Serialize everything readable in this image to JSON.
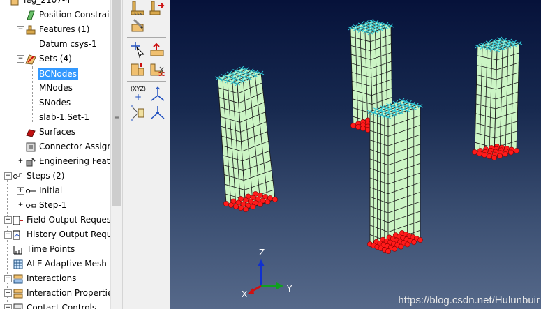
{
  "model_tree": {
    "items": [
      {
        "label": "leg_2107-4",
        "selected": false,
        "underlined": false
      },
      {
        "label": "Position Constraints",
        "selected": false,
        "underlined": false
      },
      {
        "label": "Features (1)",
        "selected": false,
        "underlined": false
      },
      {
        "label": "Datum csys-1",
        "selected": false,
        "underlined": false
      },
      {
        "label": "Sets (4)",
        "selected": false,
        "underlined": false
      },
      {
        "label": "BCNodes",
        "selected": true,
        "underlined": false
      },
      {
        "label": "MNodes",
        "selected": false,
        "underlined": false
      },
      {
        "label": "SNodes",
        "selected": false,
        "underlined": false
      },
      {
        "label": "slab-1.Set-1",
        "selected": false,
        "underlined": false
      },
      {
        "label": "Surfaces",
        "selected": false,
        "underlined": false
      },
      {
        "label": "Connector Assignments",
        "selected": false,
        "underlined": false
      },
      {
        "label": "Engineering Features",
        "selected": false,
        "underlined": false
      },
      {
        "label": "Steps (2)",
        "selected": false,
        "underlined": false
      },
      {
        "label": "Initial",
        "selected": false,
        "underlined": false
      },
      {
        "label": "Step-1",
        "selected": false,
        "underlined": true
      },
      {
        "label": "Field Output Requests",
        "selected": false,
        "underlined": false
      },
      {
        "label": "History Output Requests",
        "selected": false,
        "underlined": false
      },
      {
        "label": "Time Points",
        "selected": false,
        "underlined": false
      },
      {
        "label": "ALE Adaptive Mesh Constraints",
        "selected": false,
        "underlined": false
      },
      {
        "label": "Interactions",
        "selected": false,
        "underlined": false
      },
      {
        "label": "Interaction Properties",
        "selected": false,
        "underlined": false
      },
      {
        "label": "Contact Controls",
        "selected": false,
        "underlined": false
      }
    ]
  },
  "toolbox": {
    "icons": [
      "bc-create-icon",
      "bc-manager-icon",
      "load-edit-icon",
      "create-datum-point-icon",
      "select-node-icon",
      "assign-load-icon",
      "query-cut-icon",
      "xyz-datum-icon",
      "csys-axes-icon",
      "partition-face-icon",
      "datum-axes-icon"
    ],
    "xyz_label": "(XYZ)"
  },
  "viewport": {
    "triad": {
      "x": "X",
      "y": "Y",
      "z": "Z"
    },
    "mesh_color": "#ccf5c5",
    "bc_node_color": "#ff1a1a",
    "constraint_color": "#30c8d8",
    "watermark": "https://blog.csdn.net/Hulunbuir"
  }
}
